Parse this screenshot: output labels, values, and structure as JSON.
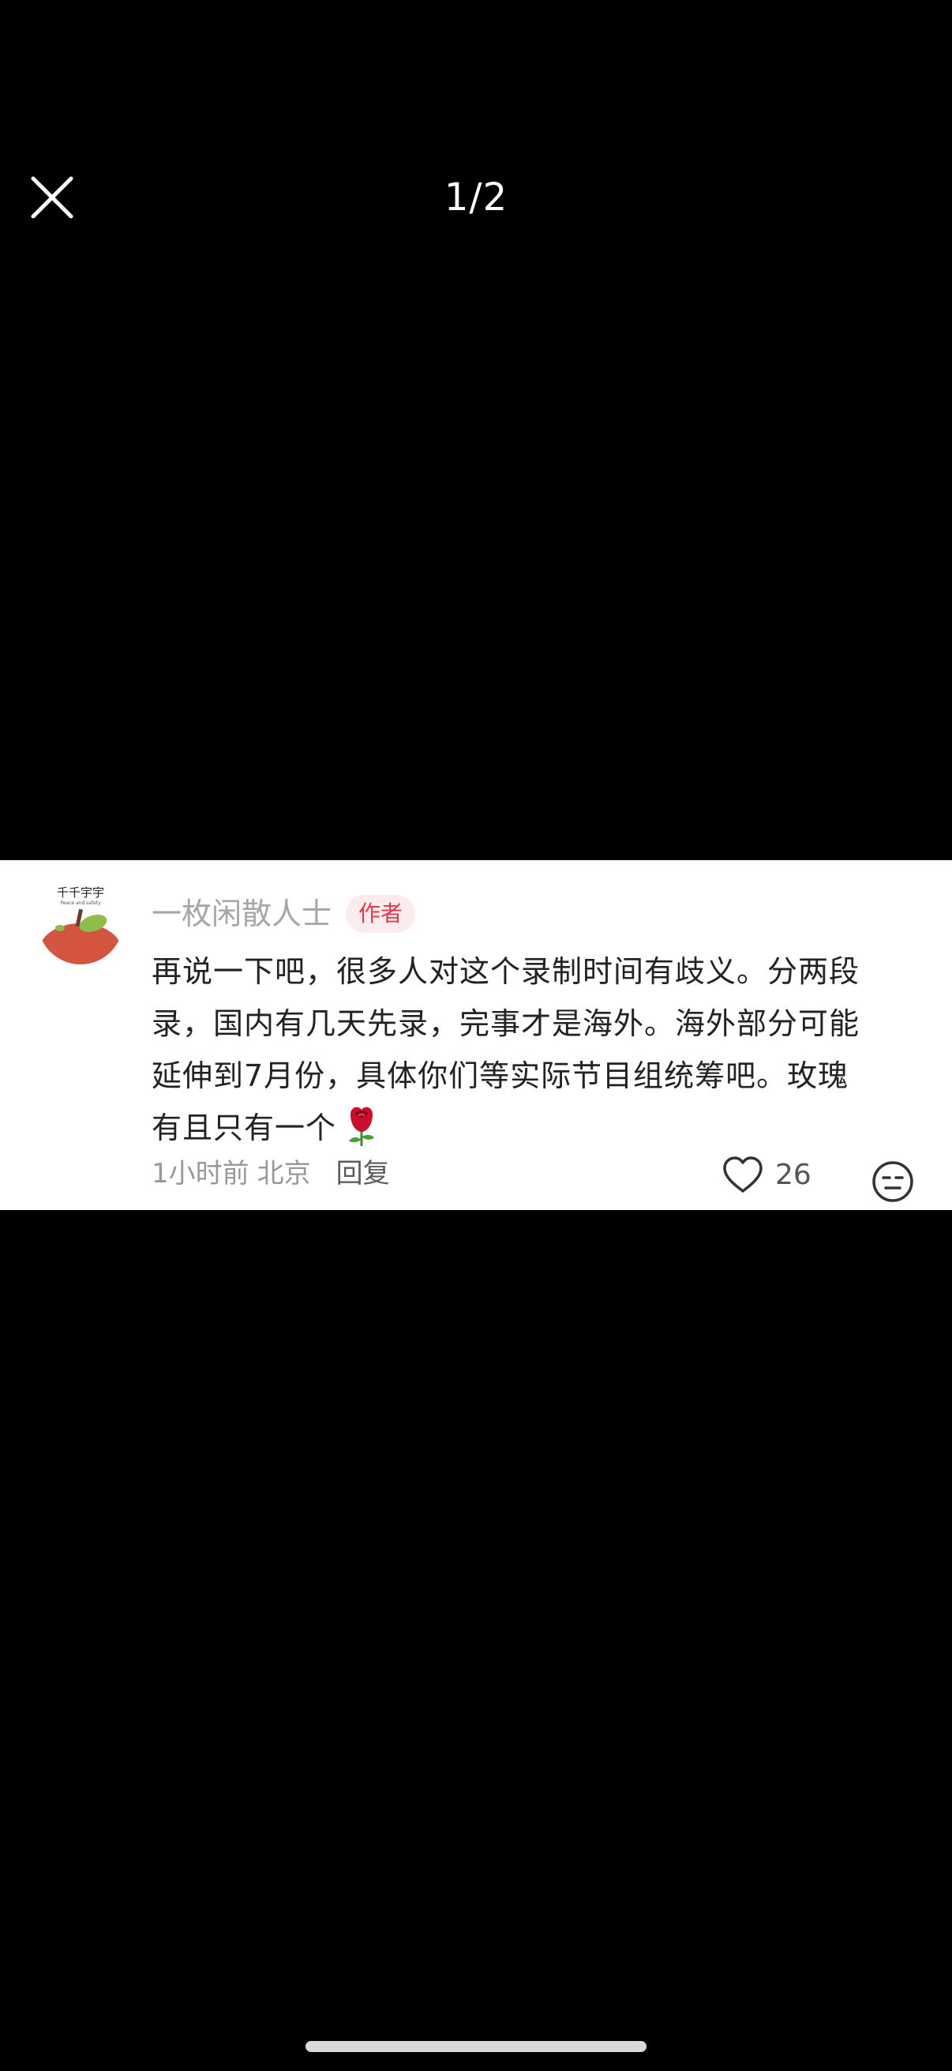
{
  "header": {
    "page_indicator": "1/2",
    "close_icon": "close-icon"
  },
  "comment": {
    "username": "一枚闲散人士",
    "badge": "作者",
    "avatar_text": "千千宇宇",
    "avatar_subtext": "Peace and safety",
    "text_lines": [
      "再说一下吧，很多人对这个录制时间有歧义。分两段",
      "录，国内有几天先录，完事才是海外。海外部分可能",
      "延伸到7月份，具体你们等实际节目组统筹吧。玫瑰",
      "有且只有一个"
    ],
    "trailing_emoji": "rose-icon",
    "time": "1小时前",
    "location": "北京",
    "reply_label": "回复",
    "like_count": "26",
    "like_icon": "heart-outline-icon",
    "emoji_icon": "face-emoji-icon"
  },
  "colors": {
    "background": "#000000",
    "card": "#ffffff",
    "username": "#a6a6a6",
    "badge_bg": "#fdecee",
    "badge_text": "#e0384f",
    "body_text": "#222222",
    "meta_text": "#999999"
  }
}
